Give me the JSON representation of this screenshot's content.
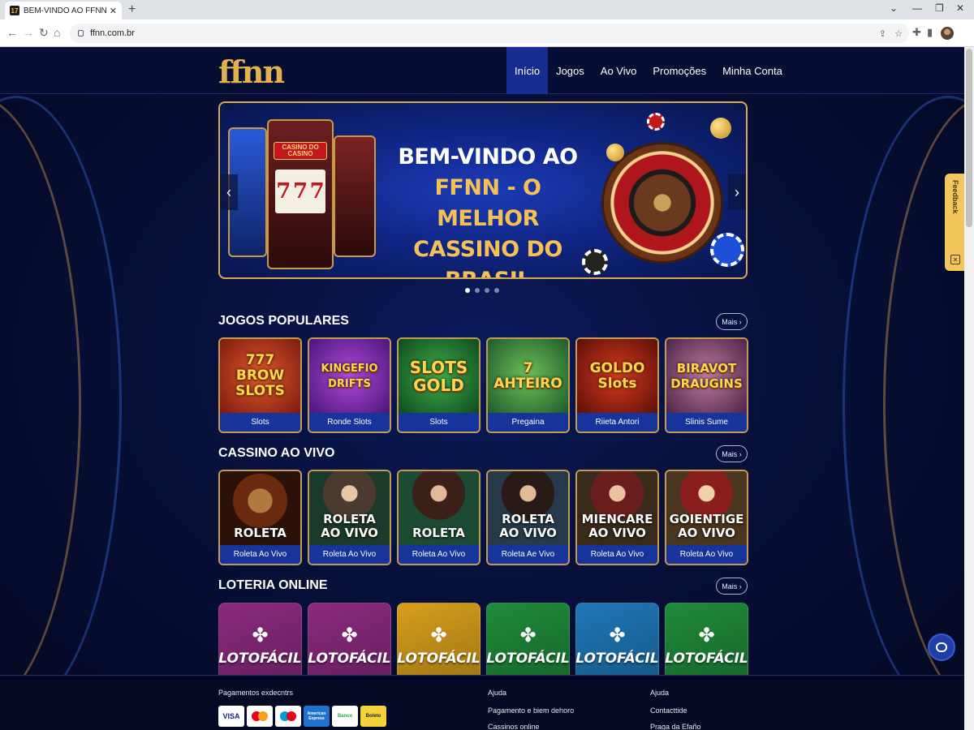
{
  "browser": {
    "tab_title": "BEM-VINDO AO FFNN - O MELHOR",
    "tab_favicon": "17",
    "url": "ffnn.com.br"
  },
  "header": {
    "logo": "ffnn",
    "nav": [
      "Início",
      "Jogos",
      "Ao Vivo",
      "Promoções",
      "Minha Conta"
    ],
    "active_index": 0
  },
  "hero": {
    "line1": "BEM-VINDO AO",
    "line2": "FFNN - O MELHOR",
    "line3": "CASSINO DO BRASIL",
    "machine_sign": "CASINO DO CASINO",
    "reels": [
      "7",
      "7",
      "7"
    ],
    "slides_total": 4,
    "slide_active": 1
  },
  "sections": {
    "popular": {
      "title": "JOGOS POPULARES",
      "more": "Mais",
      "games": [
        {
          "art": "777 BROW SLOTS",
          "caption": "Slots"
        },
        {
          "art": "KINGEFIO DRIFTS",
          "caption": "Ronde Slots"
        },
        {
          "art": "SLOTS GOLD",
          "caption": "Slots"
        },
        {
          "art": "7 AHTEIRO",
          "caption": "Pregaina"
        },
        {
          "art": "GOLDO Slots",
          "caption": "Riieta Antori"
        },
        {
          "art": "BIRAVOT DRAUGINS",
          "caption": "Slinis Sume"
        }
      ]
    },
    "live": {
      "title": "CASSINO AO VIVO",
      "more": "Mais",
      "games": [
        {
          "art": "ROLETA",
          "caption": "Roleta Ao Vivo"
        },
        {
          "art": "ROLETA AO VIVO",
          "caption": "Roleta Ao Vivo"
        },
        {
          "art": "ROLETA",
          "caption": "Roleta Ao Vivo"
        },
        {
          "art": "ROLETA AO VIVO",
          "caption": "Roleta Ae Vivo"
        },
        {
          "art": "MIENCARE AO VIVO",
          "caption": "Roleta Ao Vivo"
        },
        {
          "art": "GOIENTIGE AO VIVO",
          "caption": "Roleta Ao Vivo"
        }
      ]
    },
    "lottery": {
      "title": "LOTERIA ONLINE",
      "more": "Mais",
      "games": [
        {
          "name": "LOTOFÁCIL",
          "color": "#8b2a7e"
        },
        {
          "name": "LOTOFÁCIL",
          "color": "#8b2a7e"
        },
        {
          "name": "LOTOFÁCIL",
          "color": "#d79f1c"
        },
        {
          "name": "LOTOFÁCIL",
          "color": "#1f8b3a"
        },
        {
          "name": "LOTOFÁCIL",
          "color": "#1f77b8"
        },
        {
          "name": "LOTOFÁCIL",
          "color": "#1f8b3a"
        }
      ]
    }
  },
  "side_widget": {
    "label": "Feedback"
  },
  "footer": {
    "payments_title": "Pagamentos exdecntrs",
    "payment_methods": [
      "VISA",
      "Mastercard",
      "Maestro",
      "American Express",
      "Banco",
      "Boleto"
    ],
    "col2": [
      "Ajuda",
      "Pagamento e biem dehoro",
      "Cassinos online"
    ],
    "col3": [
      "Ajuda",
      "Contacttide",
      "Praga da Efaño"
    ]
  },
  "colors": {
    "accent_gold": "#d7aa4f",
    "nav_active": "#162c8f",
    "background": "#070d2b"
  }
}
